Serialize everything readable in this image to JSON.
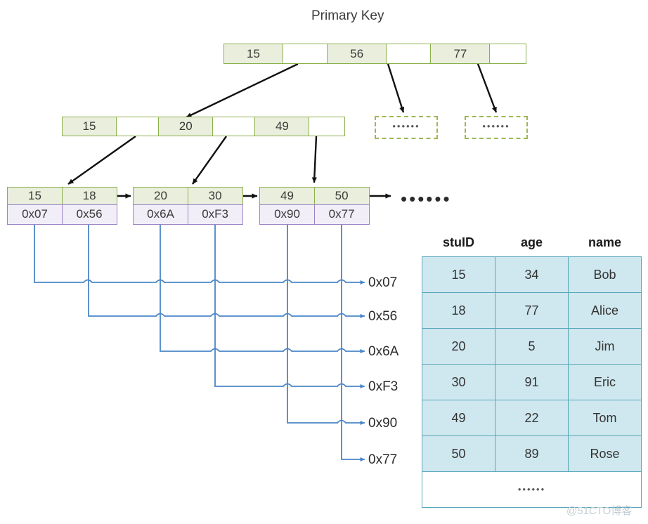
{
  "title": "Primary Key",
  "colors": {
    "key_fill": "#e9eedd",
    "key_border": "#8cb04b",
    "pointer_fill": "#f1eef8",
    "pointer_border": "#9b84c4",
    "table_fill": "#cfe7ee",
    "table_border": "#56a7bb",
    "wire": "#4a86c8",
    "arrow": "#111111"
  },
  "root_node": {
    "cells": [
      {
        "label": "15",
        "blank": false
      },
      {
        "label": "",
        "blank": true
      },
      {
        "label": "56",
        "blank": false
      },
      {
        "label": "",
        "blank": true
      },
      {
        "label": "77",
        "blank": false
      },
      {
        "label": "",
        "blank": true
      }
    ]
  },
  "internal_node": {
    "cells": [
      {
        "label": "15",
        "blank": false
      },
      {
        "label": "",
        "blank": true
      },
      {
        "label": "20",
        "blank": false
      },
      {
        "label": "",
        "blank": true
      },
      {
        "label": "49",
        "blank": false
      },
      {
        "label": "",
        "blank": true
      }
    ]
  },
  "placeholder_boxes": [
    {
      "label": "••••••"
    },
    {
      "label": "••••••"
    }
  ],
  "leaf_nodes": [
    {
      "keys": [
        "15",
        "18"
      ],
      "pointers": [
        "0x07",
        "0x56"
      ]
    },
    {
      "keys": [
        "20",
        "30"
      ],
      "pointers": [
        "0x6A",
        "0xF3"
      ]
    },
    {
      "keys": [
        "49",
        "50"
      ],
      "pointers": [
        "0x90",
        "0x77"
      ]
    }
  ],
  "leaf_tail_dots": "••••••",
  "address_labels": [
    "0x07",
    "0x56",
    "0x6A",
    "0xF3",
    "0x90",
    "0x77"
  ],
  "data_table": {
    "headers": [
      "stuID",
      "age",
      "name"
    ],
    "rows": [
      [
        "15",
        "34",
        "Bob"
      ],
      [
        "18",
        "77",
        "Alice"
      ],
      [
        "20",
        "5",
        "Jim"
      ],
      [
        "30",
        "91",
        "Eric"
      ],
      [
        "49",
        "22",
        "Tom"
      ],
      [
        "50",
        "89",
        "Rose"
      ]
    ],
    "continuation": "••••••"
  },
  "watermark": "@51CTO博客"
}
